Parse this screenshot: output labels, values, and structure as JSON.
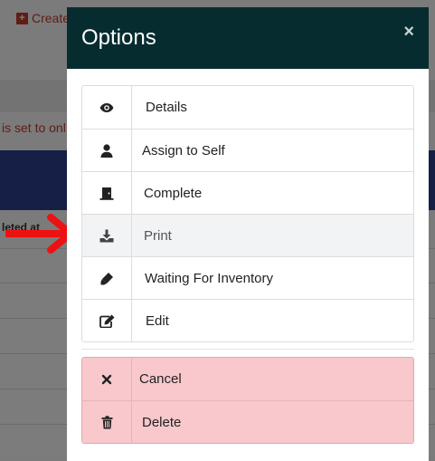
{
  "background": {
    "create_label": "Create",
    "notice_fragment": "is set to onl",
    "column_header_fragment": "leted at"
  },
  "modal": {
    "title": "Options",
    "close_glyph": "×",
    "header_color": "#072c2f",
    "options": [
      {
        "label": "Details",
        "icon": "eye-icon"
      },
      {
        "label": "Assign to Self",
        "icon": "user-icon"
      },
      {
        "label": " Complete",
        "icon": "door-icon"
      },
      {
        "label": "Print",
        "icon": "download-icon"
      },
      {
        "label": "Waiting For Inventory",
        "icon": "marker-icon"
      },
      {
        "label": "Edit",
        "icon": "edit-icon"
      }
    ],
    "danger_options": [
      {
        "label": "Cancel",
        "icon": "close-icon"
      },
      {
        "label": "Delete",
        "icon": "trash-icon"
      }
    ],
    "danger_color": "#f8c8cc"
  },
  "annotation": {
    "arrow_color": "#ee1111",
    "points_to": "Print"
  }
}
